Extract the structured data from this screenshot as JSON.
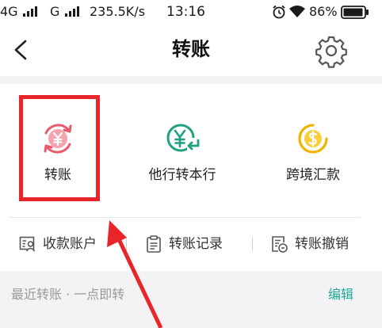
{
  "status_bar": {
    "network_1": "4G",
    "network_2": "G",
    "speed": "235.5K/s",
    "time": "13:16",
    "battery_percent": "86%"
  },
  "header": {
    "title": "转账",
    "back_icon": "chevron-left-icon",
    "settings_icon": "gear-icon"
  },
  "functions": [
    {
      "label": "转账",
      "icon": "yuan-transfer-icon",
      "color": "#e65a6a",
      "highlighted": true
    },
    {
      "label": "他行转本行",
      "icon": "yuan-return-icon",
      "color": "#1ea082",
      "highlighted": false
    },
    {
      "label": "跨境汇款",
      "icon": "dollar-transfer-icon",
      "color": "#f2b400",
      "highlighted": false
    }
  ],
  "links": [
    {
      "label": "收款账户",
      "icon": "payee-account-icon"
    },
    {
      "label": "转账记录",
      "icon": "transfer-record-icon"
    },
    {
      "label": "转账撤销",
      "icon": "transfer-cancel-icon"
    }
  ],
  "recent": {
    "title": "最近转账 · 一点即转",
    "edit_label": "编辑"
  },
  "colors": {
    "accent": "#1ea79a",
    "highlight": "#e8262a",
    "background": "#f3f3f5"
  }
}
